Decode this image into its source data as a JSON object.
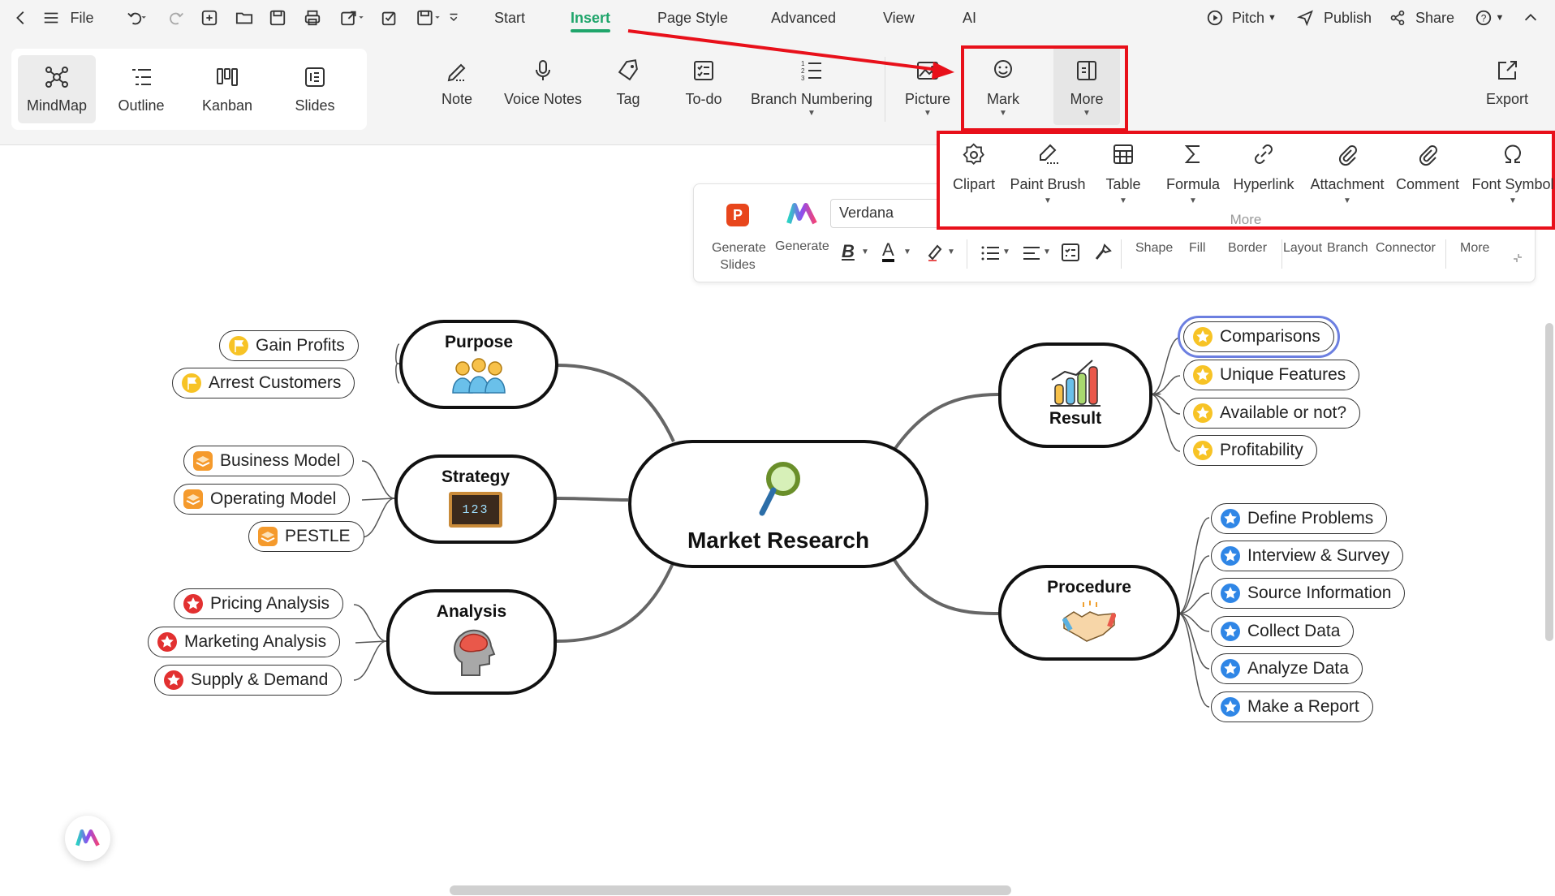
{
  "menubar": {
    "file": "File",
    "tabs": [
      "Start",
      "Insert",
      "Page Style",
      "Advanced",
      "View",
      "AI"
    ],
    "active_tab": "Insert",
    "pitch": "Pitch",
    "publish": "Publish",
    "share": "Share"
  },
  "views": [
    "MindMap",
    "Outline",
    "Kanban",
    "Slides"
  ],
  "ribbon": {
    "note": "Note",
    "voice_notes": "Voice Notes",
    "tag": "Tag",
    "todo": "To-do",
    "branch_numbering": "Branch Numbering",
    "picture": "Picture",
    "mark": "Mark",
    "more": "More",
    "export": "Export"
  },
  "more_panel": {
    "items": [
      "Clipart",
      "Paint Brush",
      "Table",
      "Formula",
      "Hyperlink",
      "Attachment",
      "Comment",
      "Font Symbol"
    ],
    "caption": "More"
  },
  "format_toolbar": {
    "generate_slides": "Generate Slides",
    "generate": "Generate",
    "font": "Verdana",
    "shape": "Shape",
    "fill": "Fill",
    "border": "Border",
    "layout": "Layout",
    "branch": "Branch",
    "connector": "Connector",
    "more": "More"
  },
  "mindmap": {
    "central": "Market Research",
    "purpose": {
      "title": "Purpose",
      "items": [
        "Gain Profits",
        "Arrest Customers"
      ]
    },
    "strategy": {
      "title": "Strategy",
      "items": [
        "Business Model",
        "Operating Model",
        "PESTLE"
      ]
    },
    "analysis": {
      "title": "Analysis",
      "items": [
        "Pricing Analysis",
        "Marketing Analysis",
        "Supply & Demand"
      ]
    },
    "result": {
      "title": "Result",
      "items": [
        "Comparisons",
        "Unique Features",
        "Available or not?",
        "Profitability"
      ]
    },
    "procedure": {
      "title": "Procedure",
      "items": [
        "Define Problems",
        "Interview & Survey",
        "Source Information",
        "Collect Data",
        "Analyze Data",
        "Make a Report"
      ]
    },
    "strategy_board_text": "123"
  },
  "colors": {
    "accent": "#1fa56b",
    "annotation_red": "#e8101a",
    "selection": "#6c7fe0",
    "flag_yellow": "#f7c325",
    "layer_orange": "#f59a2c",
    "star_red": "#e23030",
    "star_blue": "#2f86e6"
  }
}
